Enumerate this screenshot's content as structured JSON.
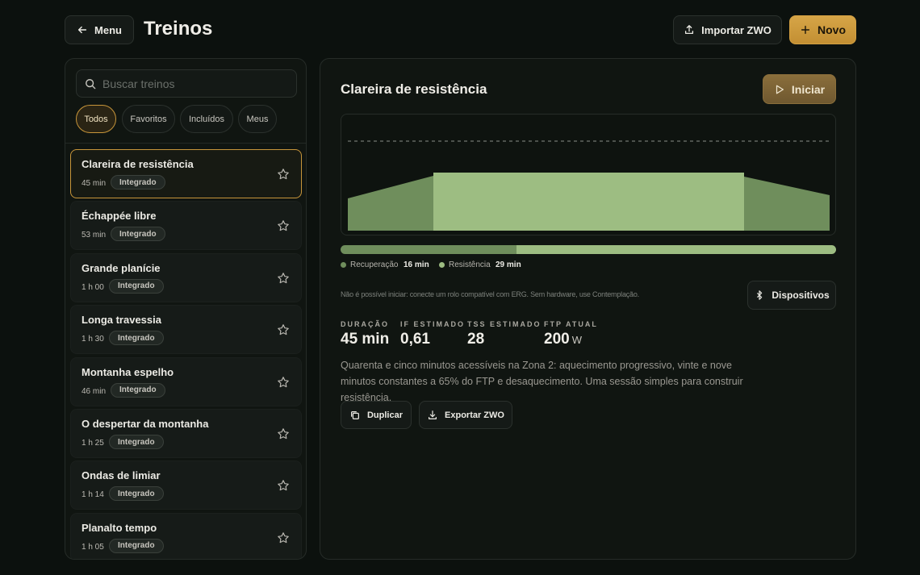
{
  "header": {
    "menu_label": "Menu",
    "title": "Treinos",
    "import_label": "Importar ZWO",
    "new_label": "Novo"
  },
  "sidebar": {
    "search_placeholder": "Buscar treinos",
    "filters": [
      "Todos",
      "Favoritos",
      "Incluídos",
      "Meus"
    ],
    "active_filter": "Todos",
    "items": [
      {
        "name": "Clareira de resistência",
        "duration": "45 min",
        "badge": "Integrado"
      },
      {
        "name": "Échappée libre",
        "duration": "53 min",
        "badge": "Integrado"
      },
      {
        "name": "Grande planície",
        "duration": "1 h 00",
        "badge": "Integrado"
      },
      {
        "name": "Longa travessia",
        "duration": "1 h 30",
        "badge": "Integrado"
      },
      {
        "name": "Montanha espelho",
        "duration": "46 min",
        "badge": "Integrado"
      },
      {
        "name": "O despertar da montanha",
        "duration": "1 h 25",
        "badge": "Integrado"
      },
      {
        "name": "Ondas de limiar",
        "duration": "1 h 14",
        "badge": "Integrado"
      },
      {
        "name": "Planalto tempo",
        "duration": "1 h 05",
        "badge": "Integrado"
      }
    ]
  },
  "detail": {
    "title": "Clareira de resistência",
    "start_label": "Iniciar",
    "zones": [
      {
        "label": "Recuperação",
        "value": "16 min"
      },
      {
        "label": "Resistência",
        "value": "29 min"
      }
    ],
    "notice": "Não é possível iniciar: conecte um rolo compatível com ERG. Sem hardware, use Contemplação.",
    "devices_label": "Dispositivos",
    "stats": [
      {
        "label": "DURAÇÃO",
        "value": "45 min",
        "unit": ""
      },
      {
        "label": "IF ESTIMADO",
        "value": "0,61",
        "unit": ""
      },
      {
        "label": "TSS ESTIMADO",
        "value": "28",
        "unit": ""
      },
      {
        "label": "FTP ATUAL",
        "value": "200",
        "unit": "W"
      }
    ],
    "description": "Quarenta e cinco minutos acessíveis na Zona 2: aquecimento progressivo, vinte e nove minutos constantes a 65% do FTP e desaquecimento. Uma sessão simples para construir resistência.",
    "duplicate_label": "Duplicar",
    "export_label": "Exportar ZWO"
  },
  "colors": {
    "accent": "#c7953a",
    "recovery": "#6f8e5c",
    "endurance": "#9dbd82"
  }
}
